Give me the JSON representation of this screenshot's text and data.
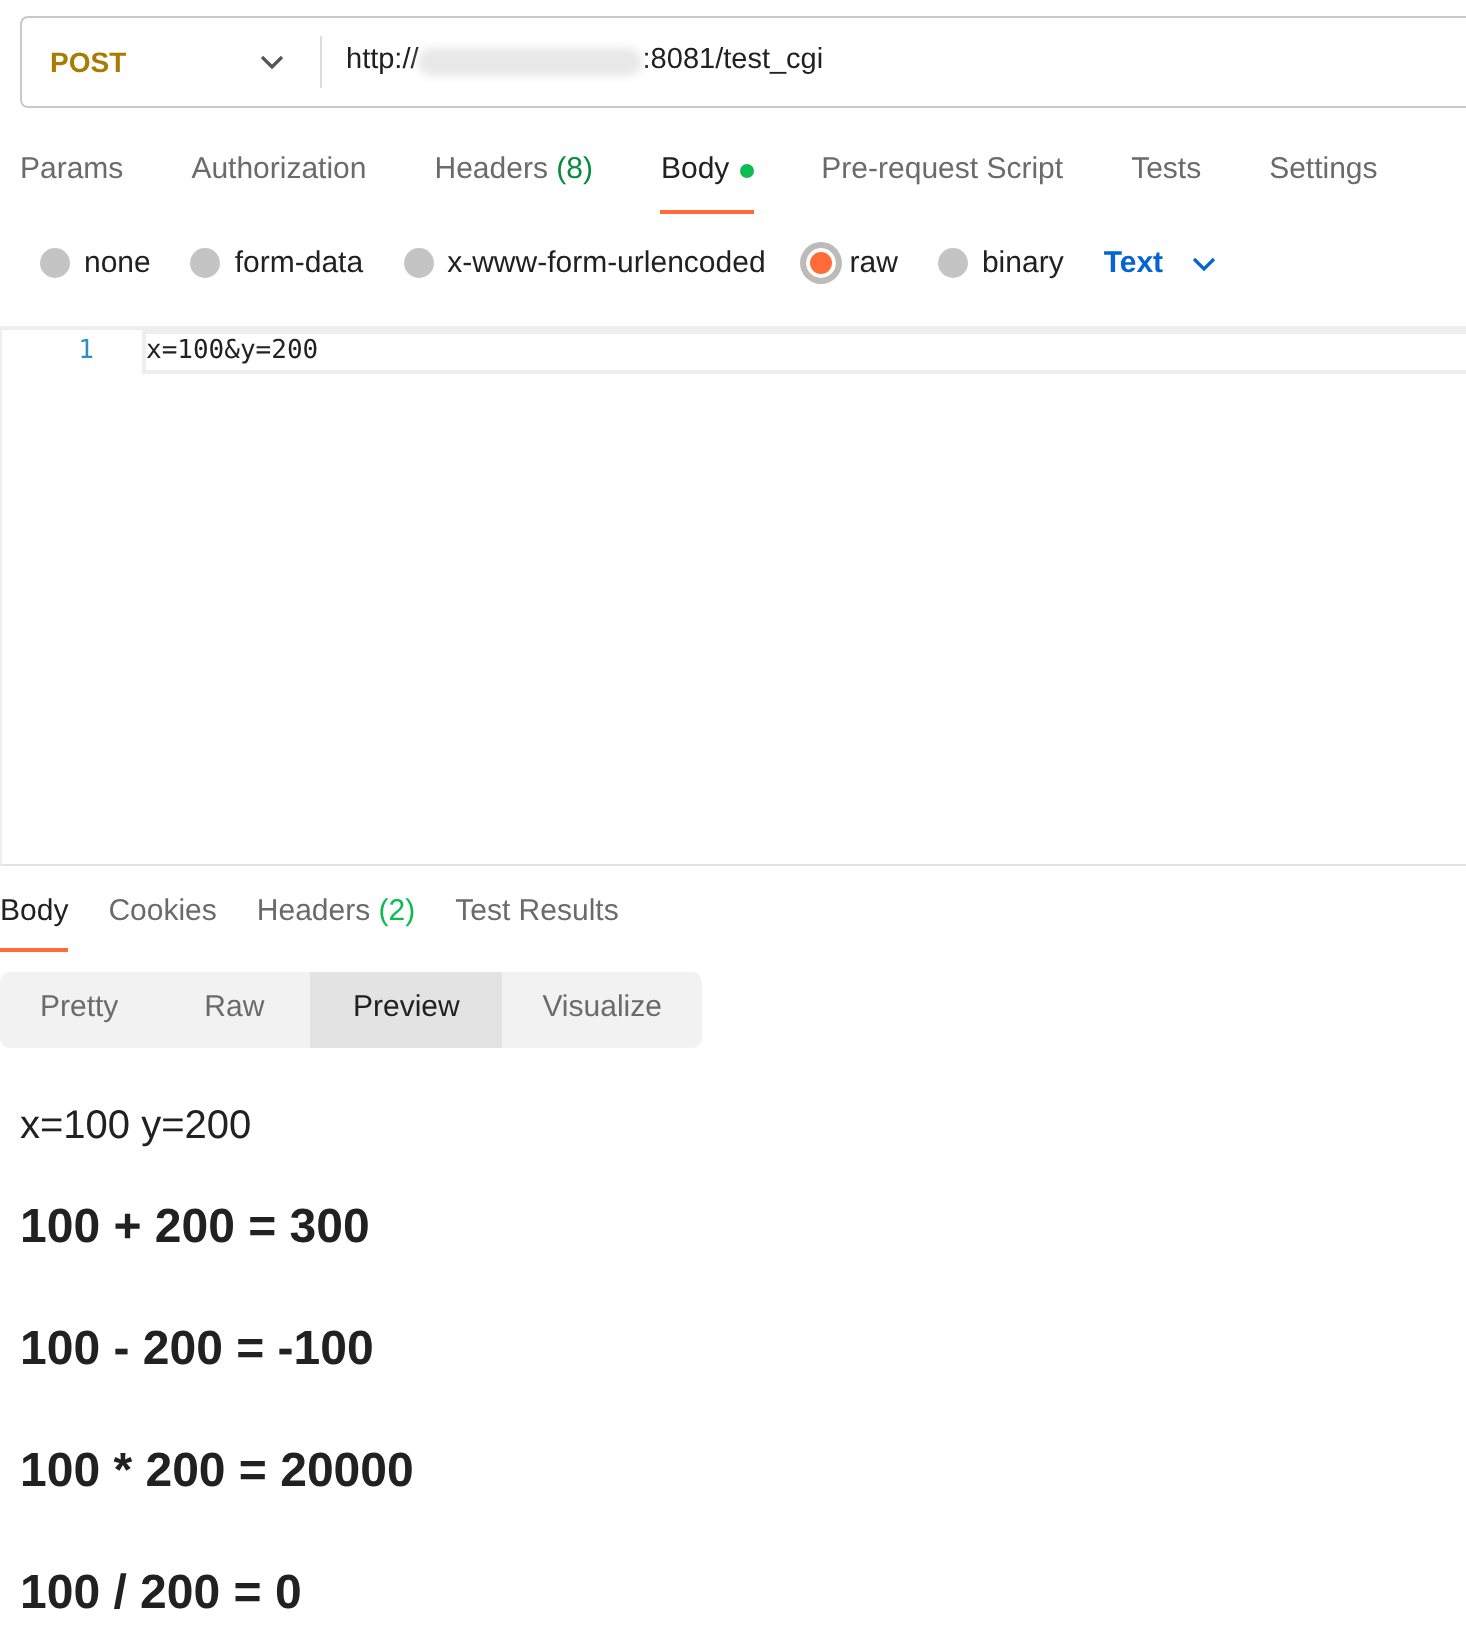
{
  "request": {
    "method": "POST",
    "url_start": "http://",
    "url_end": ":8081/test_cgi"
  },
  "request_tabs": [
    {
      "label": "Params",
      "selected": false
    },
    {
      "label": "Authorization",
      "selected": false
    },
    {
      "label": "Headers",
      "count": "(8)",
      "selected": false
    },
    {
      "label": "Body",
      "dot": true,
      "selected": true
    },
    {
      "label": "Pre-request Script",
      "selected": false
    },
    {
      "label": "Tests",
      "selected": false
    },
    {
      "label": "Settings",
      "selected": false
    }
  ],
  "body_types": [
    {
      "label": "none",
      "selected": false
    },
    {
      "label": "form-data",
      "selected": false
    },
    {
      "label": "x-www-form-urlencoded",
      "selected": false
    },
    {
      "label": "raw",
      "selected": true
    },
    {
      "label": "binary",
      "selected": false
    }
  ],
  "format": "Text",
  "editor": {
    "lines": [
      {
        "number": "1",
        "text": "x=100&y=200"
      }
    ]
  },
  "response_tabs": [
    {
      "label": "Body",
      "selected": true
    },
    {
      "label": "Cookies",
      "selected": false
    },
    {
      "label": "Headers",
      "count": "(2)",
      "selected": false
    },
    {
      "label": "Test Results",
      "selected": false
    }
  ],
  "view_modes": [
    {
      "label": "Pretty",
      "selected": false
    },
    {
      "label": "Raw",
      "selected": false
    },
    {
      "label": "Preview",
      "selected": true
    },
    {
      "label": "Visualize",
      "selected": false
    }
  ],
  "preview": [
    {
      "kind": "text",
      "text": "x=100 y=200"
    },
    {
      "kind": "heading",
      "text": "100 + 200 = 300"
    },
    {
      "kind": "heading",
      "text": "100 - 200 = -100"
    },
    {
      "kind": "heading",
      "text": "100 * 200 = 20000"
    },
    {
      "kind": "heading",
      "text": "100 / 200 = 0"
    }
  ]
}
